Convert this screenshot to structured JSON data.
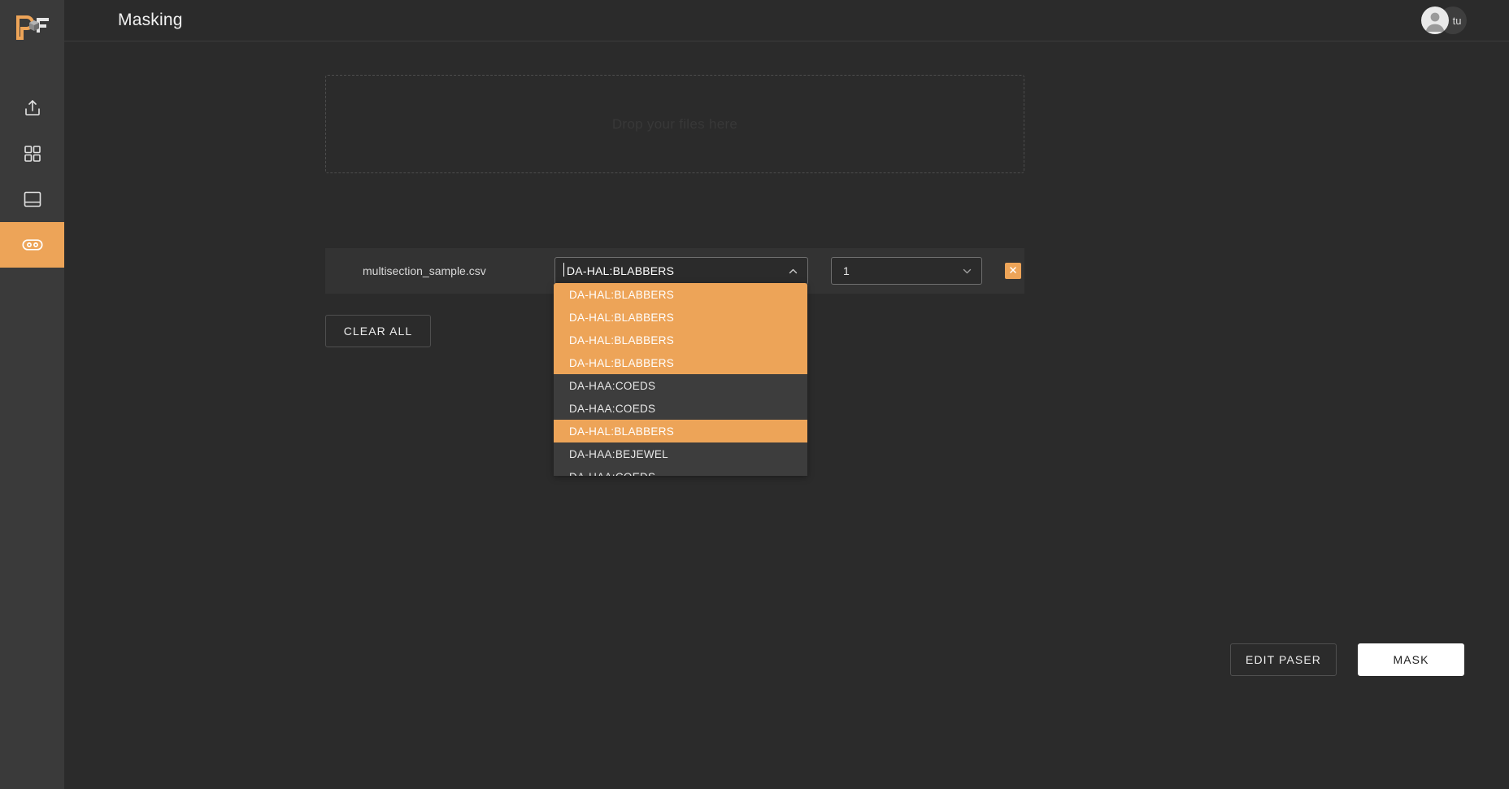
{
  "app": {
    "logo_text": "PF",
    "accent_color": "#eda458",
    "background_color": "#2b2b2b",
    "sidebar_color": "#3a3a3a"
  },
  "sidebar": {
    "items": [
      {
        "name": "upload",
        "icon": "upload-icon",
        "active": false
      },
      {
        "name": "grid",
        "icon": "grid-icon",
        "active": false
      },
      {
        "name": "library",
        "icon": "library-icon",
        "active": false
      },
      {
        "name": "link",
        "icon": "link-icon",
        "active": true
      }
    ]
  },
  "header": {
    "title": "Masking",
    "avatar_initials": "tu"
  },
  "dropzone": {
    "text": "Drop your files here"
  },
  "file_row": {
    "file_name": "multisection_sample.csv",
    "tag_select_value": "DA-HAL:BLABBERS",
    "count_select_value": "1",
    "remove_label": "✕"
  },
  "tag_menu": {
    "options": [
      {
        "label": "DA-HAL:BLABBERS",
        "selected": true
      },
      {
        "label": "DA-HAL:BLABBERS",
        "selected": true
      },
      {
        "label": "DA-HAL:BLABBERS",
        "selected": true
      },
      {
        "label": "DA-HAL:BLABBERS",
        "selected": true
      },
      {
        "label": "DA-HAA:COEDS",
        "selected": false
      },
      {
        "label": "DA-HAA:COEDS",
        "selected": false
      },
      {
        "label": "DA-HAL:BLABBERS",
        "selected": true
      },
      {
        "label": "DA-HAA:BEJEWEL",
        "selected": false
      },
      {
        "label": "DA-HAA:COEDS",
        "selected": false
      }
    ]
  },
  "buttons": {
    "clear_all": "CLEAR ALL",
    "edit_paser": "EDIT PASER",
    "mask": "MASK"
  }
}
